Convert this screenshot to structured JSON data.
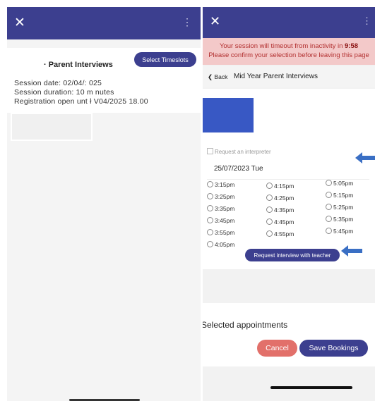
{
  "left": {
    "close_icon": "close-icon",
    "menu_icon": "more-vertical-icon",
    "title": "· Parent Interviews",
    "select_button": "Select Timeslots",
    "session_date": "Session date: 02/04/: 025",
    "session_duration": "Session duration: 10 m nutes",
    "registration": "Registration open unt ł  V04/2025 18.00"
  },
  "right": {
    "close_icon": "close-icon",
    "menu_icon": "more-vertical-icon",
    "warning_prefix": "Your session will timeout from inactivity in ",
    "timeout": "9:58",
    "warning_line2": "Please confirm your selection before leaving this page",
    "back_label": "Back",
    "page_title": "Mid Year Parent Interviews",
    "interpreter_label": "Request an interpreter",
    "date": "25/07/2023 Tue",
    "timeslots": {
      "col1": [
        "3:15pm",
        "3:25pm",
        "3:35pm",
        "3:45pm",
        "3:55pm",
        "4:05pm"
      ],
      "col2": [
        "4:15pm",
        "4:25pm",
        "4:35pm",
        "4:45pm",
        "4:55pm"
      ],
      "col3": [
        "5:05pm",
        "5:15pm",
        "5:25pm",
        "5:35pm",
        "5:45pm"
      ]
    },
    "request_button": "Request interview with teacher",
    "selected_title": "Selected appointments",
    "cancel_button": "Cancel",
    "save_button": "Save Bookings"
  },
  "colors": {
    "header": "#3c3f8f",
    "warning_bg": "#f3c9c9",
    "warning_text": "#b23030",
    "cancel": "#e2706a",
    "arrow": "#3a6fc4"
  }
}
